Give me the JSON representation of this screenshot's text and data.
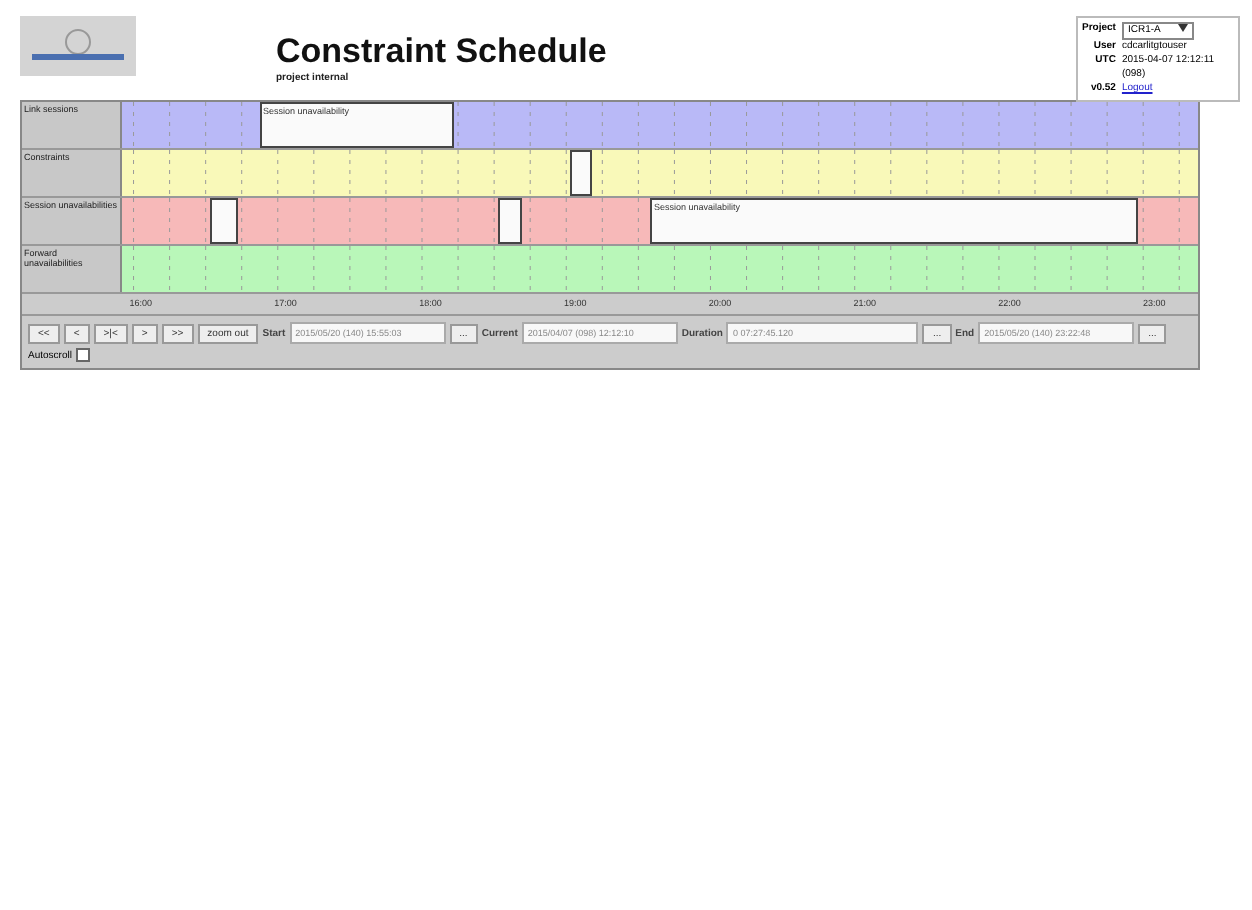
{
  "header": {
    "title": "Constraint Schedule",
    "subtitle": "project internal"
  },
  "user_panel": {
    "project_label": "Project",
    "project_value": "ICR1-A",
    "user_label": "User",
    "user_value": "cdcarlitgtouser",
    "utc_label": "UTC",
    "utc_value": "2015-04-07 12:12:11 (098)",
    "version": "v0.52",
    "logout": "Logout"
  },
  "timeline": {
    "rows": [
      {
        "label": "Link sessions",
        "blocks": [
          {
            "kind": "unavailability",
            "label": "Session unavailability"
          }
        ]
      },
      {
        "label": "Constraints",
        "blocks": [
          {
            "kind": "unavailability"
          }
        ]
      },
      {
        "label": "Session unavailabilities",
        "blocks": [
          {
            "kind": "unavailability"
          },
          {
            "kind": "unavailability"
          },
          {
            "kind": "unavailability",
            "label": "Session unavailability"
          }
        ]
      },
      {
        "label": "Forward unavailabilities"
      }
    ],
    "ticks": [
      "16:00",
      "17:00",
      "18:00",
      "19:00",
      "20:00",
      "21:00",
      "22:00",
      "23:00"
    ]
  },
  "controls": {
    "buttons": [
      "<<",
      "<",
      ">|<",
      ">",
      ">>",
      "zoom out"
    ],
    "start_label": "Start",
    "start_value": "2015/05/20 (140) 15:55:03",
    "start_button": "...",
    "current_label": "Current",
    "current_value": "2015/04/07 (098) 12:12:10",
    "duration_label": "Duration",
    "duration_value": "0 07:27:45.120",
    "duration_button": "...",
    "end_label": "End",
    "end_value": "2015/05/20 (140) 23:22:48",
    "end_button": "...",
    "autoscroll_label": "Autoscroll",
    "autoscroll": false
  }
}
